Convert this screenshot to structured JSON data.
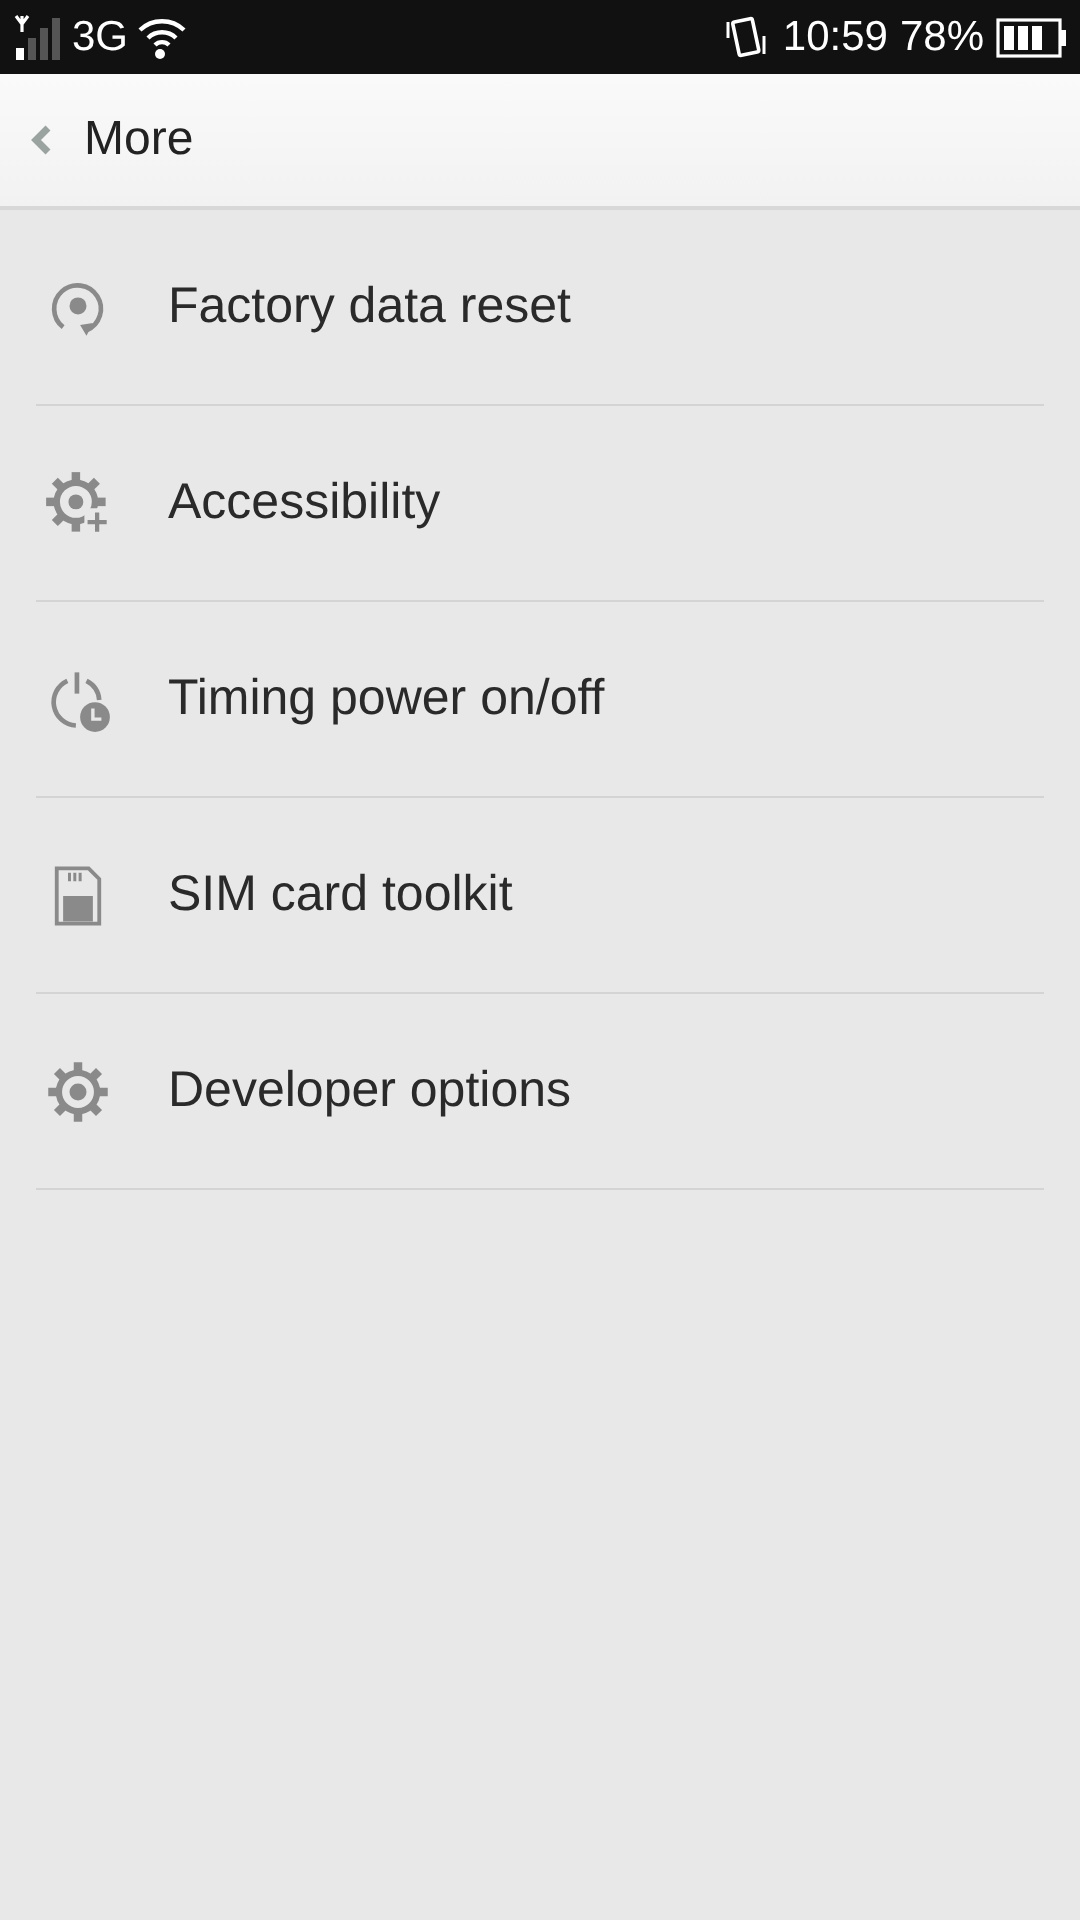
{
  "status_bar": {
    "network": "3G",
    "time": "10:59",
    "battery": "78%"
  },
  "header": {
    "title": "More"
  },
  "items": [
    {
      "kind": "reset",
      "label": "Factory data reset"
    },
    {
      "kind": "accessibility",
      "label": "Accessibility"
    },
    {
      "kind": "timer",
      "label": "Timing power on/off"
    },
    {
      "kind": "sim",
      "label": "SIM card toolkit"
    },
    {
      "kind": "gear",
      "label": "Developer options"
    }
  ]
}
